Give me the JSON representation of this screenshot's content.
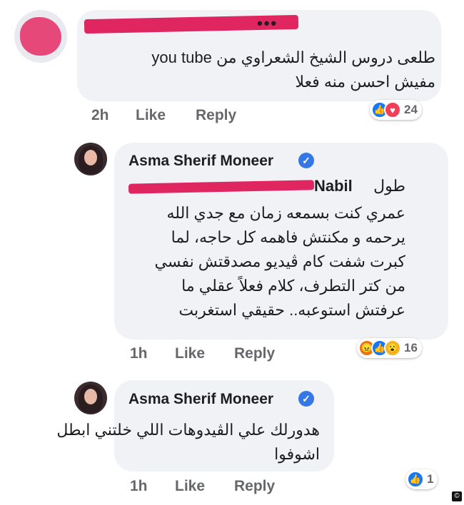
{
  "comment1": {
    "lines": [
      "طلعى دروس الشيخ الشعراوي من you tube",
      "مفيش احسن منه فعلا"
    ],
    "time": "2h",
    "like_label": "Like",
    "reply_label": "Reply",
    "reaction_count": "24",
    "reactions": [
      "like-icon",
      "love-icon"
    ]
  },
  "comment2": {
    "author": "Asma Sherif Moneer",
    "mention_visible": "Nabil",
    "mention_prefix": "طول",
    "lines": [
      "عمري كنت بسمعه زمان مع جدي الله",
      "يرحمه و مكنتش فاهمه كل حاجه، لما",
      "كبرت شفت كام ڤيديو مصدقتش نفسي",
      "من كتر التطرف، كلام فعلاً عقلي ما",
      "عرفتش استوعبه.. حقيقي استغربت"
    ],
    "time": "1h",
    "like_label": "Like",
    "reply_label": "Reply",
    "reaction_count": "16",
    "reactions": [
      "angry-icon",
      "like-icon",
      "wow-icon"
    ]
  },
  "comment3": {
    "author": "Asma Sherif Moneer",
    "lines": [
      "هدورلك علي الڤيدوهات اللي خلتني ابطل",
      "اشوفوا"
    ],
    "time": "1h",
    "like_label": "Like",
    "reply_label": "Reply",
    "reaction_count": "1",
    "reactions": [
      "like-icon"
    ]
  },
  "colors": {
    "bubble": "#f0f2f5",
    "redaction": "#e02660",
    "like": "#1877f2",
    "love": "#f33e58",
    "verified": "#3578e5"
  },
  "watermark": "©"
}
